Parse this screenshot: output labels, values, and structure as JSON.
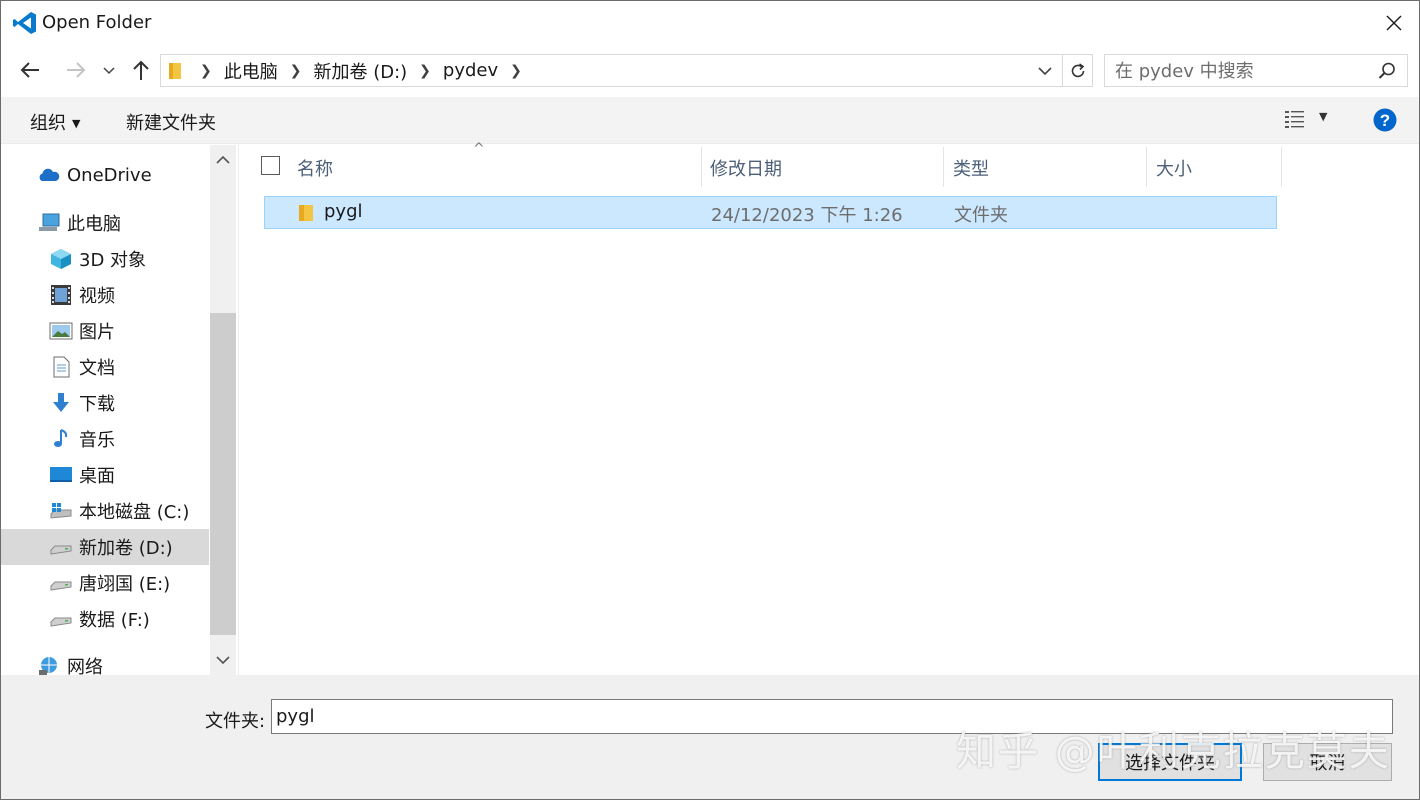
{
  "window": {
    "title": "Open Folder"
  },
  "address": {
    "breadcrumbs": [
      "此电脑",
      "新加卷 (D:)",
      "pydev"
    ]
  },
  "search": {
    "placeholder": "在 pydev 中搜索"
  },
  "toolbar": {
    "organize_label": "组织",
    "new_folder_label": "新建文件夹"
  },
  "nav": {
    "items": [
      {
        "label": "OneDrive",
        "icon": "cloud-icon"
      },
      {
        "label": "此电脑",
        "icon": "computer-icon"
      },
      {
        "label": "3D 对象",
        "icon": "cube-icon"
      },
      {
        "label": "视频",
        "icon": "video-icon"
      },
      {
        "label": "图片",
        "icon": "picture-icon"
      },
      {
        "label": "文档",
        "icon": "document-icon"
      },
      {
        "label": "下载",
        "icon": "download-icon"
      },
      {
        "label": "音乐",
        "icon": "music-icon"
      },
      {
        "label": "桌面",
        "icon": "desktop-icon"
      },
      {
        "label": "本地磁盘 (C:)",
        "icon": "windows-drive-icon"
      },
      {
        "label": "新加卷 (D:)",
        "icon": "drive-icon",
        "selected": true
      },
      {
        "label": "唐翊国 (E:)",
        "icon": "drive-icon"
      },
      {
        "label": "数据 (F:)",
        "icon": "drive-icon"
      },
      {
        "label": "网络",
        "icon": "network-icon"
      }
    ]
  },
  "columns": {
    "name": "名称",
    "modified": "修改日期",
    "type": "类型",
    "size": "大小"
  },
  "files": [
    {
      "name": "pygl",
      "modified": "24/12/2023 下午 1:26",
      "type": "文件夹",
      "size": ""
    }
  ],
  "footer": {
    "folder_label": "文件夹:",
    "folder_value": "pygl",
    "select_button": "选择文件夹",
    "cancel_button": "取消"
  },
  "watermark": "知乎 @叶利克拉克莫夫",
  "colors": {
    "accent": "#0078d7",
    "selection": "#cce8ff",
    "header_text": "#4c607a"
  }
}
